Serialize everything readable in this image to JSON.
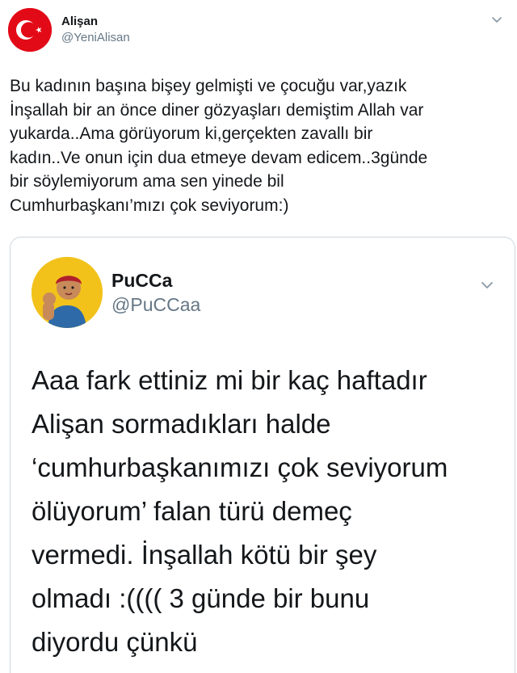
{
  "tweet": {
    "author_name": "Alişan",
    "author_handle": "@YeniAlisan",
    "text": "Bu kadının başına bişey gelmişti ve çocuğu var,yazık\nİnşallah bir an önce diner gözyaşları demiştim Allah var\nyukarda..Ama görüyorum ki,gerçekten zavallı bir\nkadın..Ve onun için dua etmeye devam edicem..3günde\nbir söylemiyorum ama sen yinede bil\nCumhurbaşkanı’mızı çok seviyorum:)",
    "avatar_icon": "turkish-flag-avatar",
    "menu_icon": "chevron-down-icon"
  },
  "quoted_tweet": {
    "author_name": "PuCCa",
    "author_handle": "@PuCCaa",
    "text": "Aaa fark ettiniz mi bir kaç haftadır\nAlişan sormadıkları halde\n‘cumhurbaşkanımızı çok seviyorum\nölüyorum’ falan türü demeç\nvermedi. İnşallah kötü bir şey\nolmadı :(((( 3 günde bir bunu\ndiyordu çünkü",
    "avatar_icon": "profile-photo-avatar",
    "menu_icon": "chevron-down-icon"
  },
  "colors": {
    "text_primary": "#14171a",
    "text_secondary": "#657786",
    "border": "#ccd6dd",
    "flag_red": "#e30a17"
  }
}
